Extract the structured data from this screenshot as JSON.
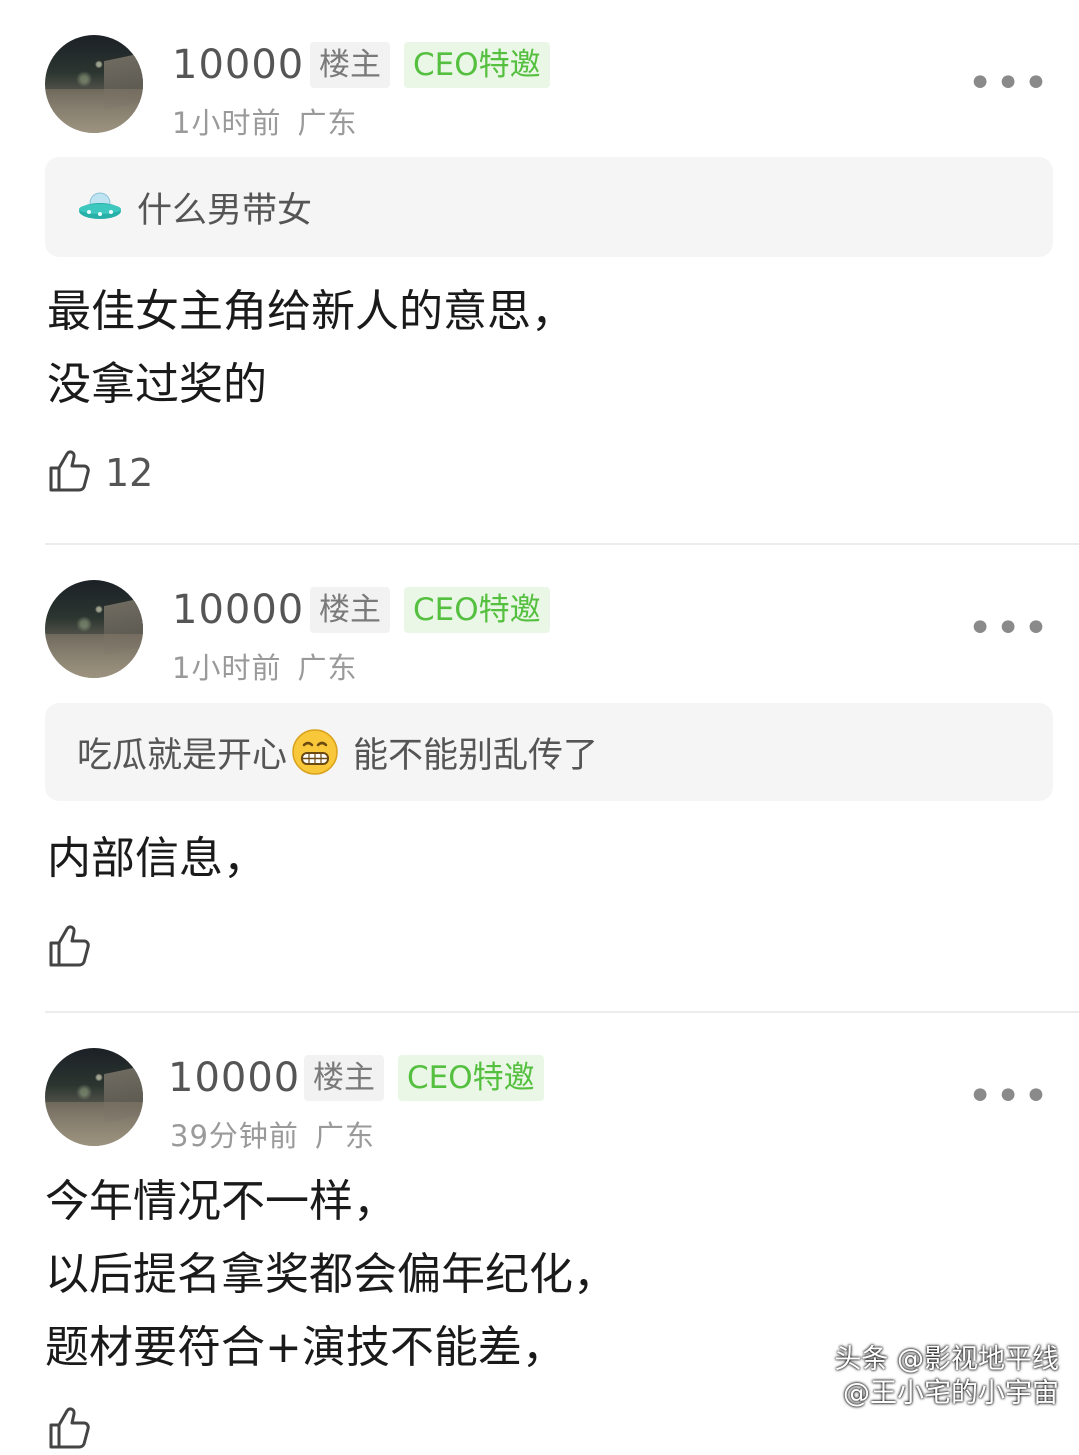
{
  "comments": [
    {
      "username": "10000",
      "badge_op": "楼主",
      "badge_ceo": "CEO特邀",
      "time": "1小时前",
      "location": "广东",
      "more": "•••",
      "quote": "什么男带女",
      "quote_icon": "ufo-icon",
      "body_lines": [
        "最佳女主角给新人的意思，",
        "没拿过奖的"
      ],
      "likes": "12"
    },
    {
      "username": "10000",
      "badge_op": "楼主",
      "badge_ceo": "CEO特邀",
      "time": "1小时前",
      "location": "广东",
      "more": "•••",
      "quote_before": "吃瓜就是开心",
      "quote_after": "能不能别乱传了",
      "quote_emoji": "grin-emoji",
      "body_lines": [
        "内部信息，"
      ],
      "likes": ""
    },
    {
      "username": "10000",
      "badge_op": "楼主",
      "badge_ceo": "CEO特邀",
      "time": "39分钟前",
      "location": "广东",
      "more": "•••",
      "body_lines": [
        "今年情况不一样，",
        "以后提名拿奖都会偏年纪化，",
        "题材要符合+演技不能差，"
      ],
      "likes": ""
    }
  ],
  "watermark": {
    "line1": "头条 @影视地平线",
    "line2": "@王小宅的小宇宙"
  },
  "colors": {
    "ceo_badge_text": "#55c040",
    "ceo_badge_bg": "#eaf7e6",
    "op_badge_bg": "#f2f2f2",
    "quote_bg": "#f5f5f5"
  }
}
